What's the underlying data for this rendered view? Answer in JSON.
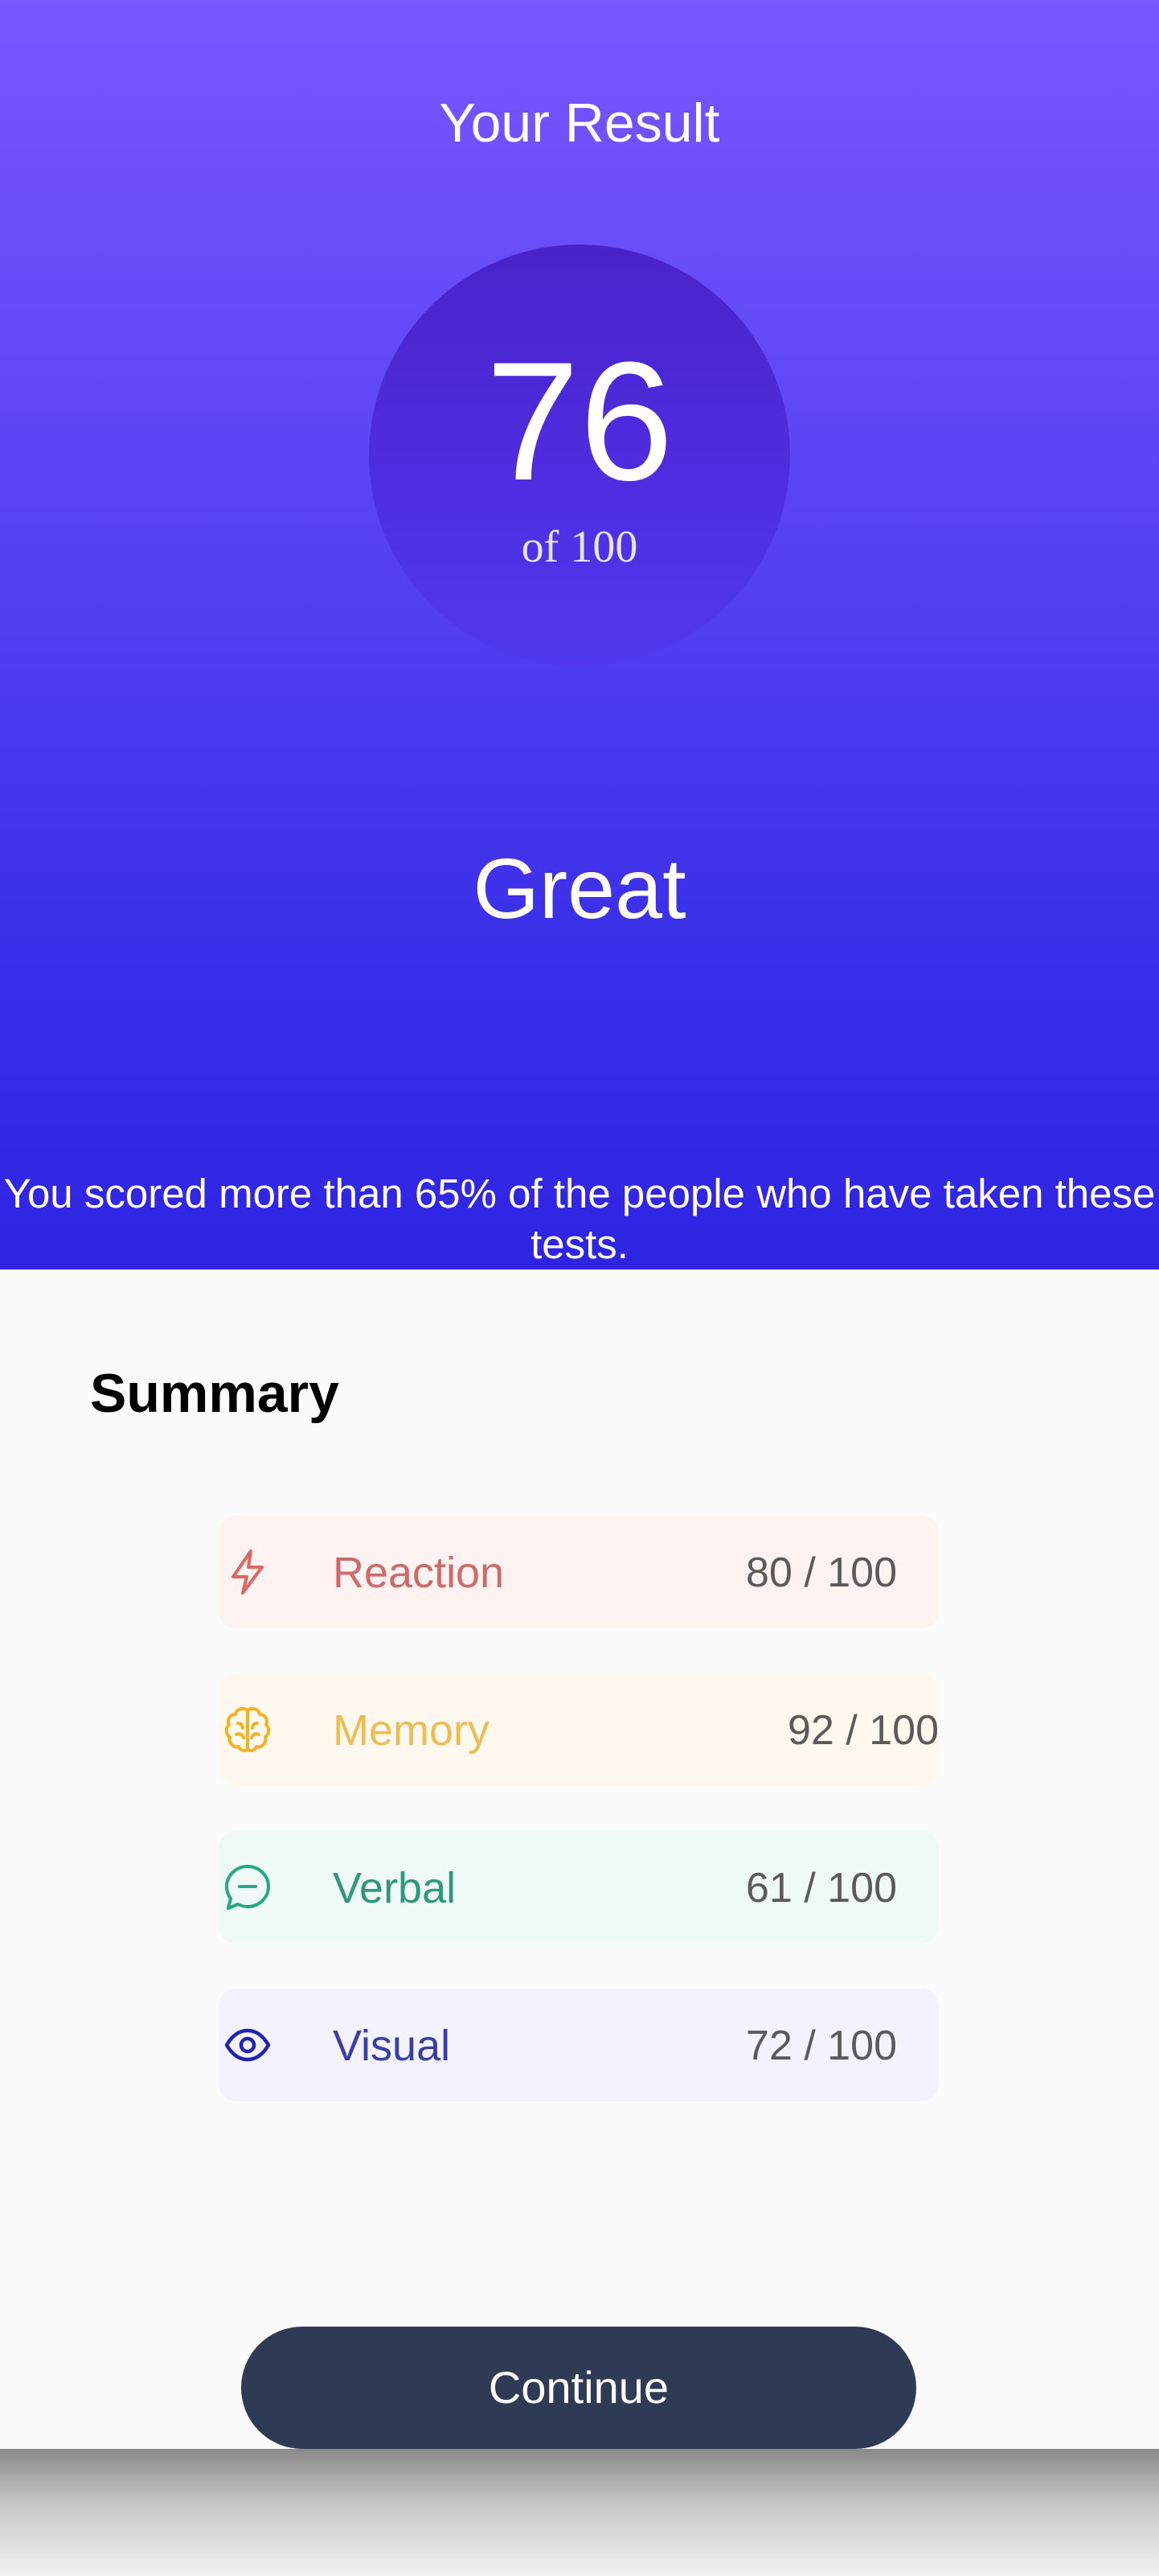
{
  "header": {
    "title": "Your Result",
    "score": "76",
    "score_max": "of 100",
    "grade": "Great",
    "percentile_text": "You scored more than 65% of the people who have taken these tests."
  },
  "summary": {
    "title": "Summary",
    "items": [
      {
        "label": "Reaction",
        "score": "80 / 100",
        "icon": "lightning-icon",
        "color": "#cf6a6a"
      },
      {
        "label": "Memory",
        "score": "92 / 100",
        "icon": "brain-icon",
        "color": "#ecbd55"
      },
      {
        "label": "Verbal",
        "score": "61 / 100",
        "icon": "chat-bubble-icon",
        "color": "#2f987a"
      },
      {
        "label": "Visual",
        "score": "72 / 100",
        "icon": "eye-icon",
        "color": "#3b3ea9"
      }
    ]
  },
  "actions": {
    "continue_label": "Continue"
  },
  "colors": {
    "hero_top": "#7857ff",
    "hero_bottom": "#2e24e2",
    "button": "#2f3a55"
  }
}
